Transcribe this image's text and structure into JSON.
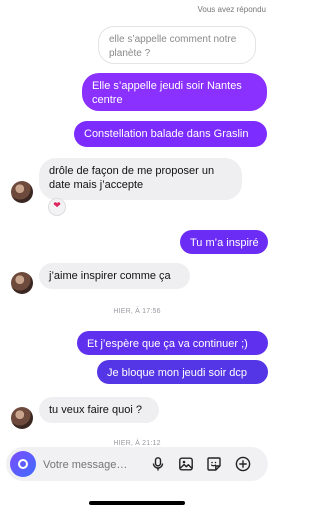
{
  "header": {
    "reply_meta": "Vous avez répondu"
  },
  "reply_to": {
    "text": "elle s’appelle comment notre planète ?"
  },
  "messages": [
    {
      "side": "out",
      "text": "Elle s’appelle jeudi soir Nantes centre"
    },
    {
      "side": "out",
      "text": "Constellation balade dans Graslin"
    },
    {
      "side": "in",
      "text": "drôle de façon de me proposer un date mais j’accepte",
      "reaction": "❤"
    },
    {
      "side": "out",
      "text": "Tu m’a inspiré"
    },
    {
      "side": "in",
      "text": "j’aime inspirer comme ça"
    },
    {
      "timestamp": "HIER, À 17:56"
    },
    {
      "side": "out",
      "text": "Et j’espère que ça va continuer ;)"
    },
    {
      "side": "out",
      "text": "Je bloque mon jeudi soir dcp"
    },
    {
      "side": "in",
      "text": "tu veux faire quoi ?"
    },
    {
      "timestamp": "HIER, À 21:12"
    }
  ],
  "composer": {
    "placeholder": "Votre message…"
  },
  "icons": {
    "camera": "camera-icon",
    "microphone": "microphone-icon",
    "gallery": "gallery-icon",
    "sticker": "sticker-icon",
    "plus": "plus-icon"
  },
  "colors": {
    "outgoing_bubble": "#7a2cff",
    "incoming_bubble": "#efeff1",
    "camera_gradient_start": "#7b4dff",
    "camera_gradient_end": "#3f6bff"
  }
}
